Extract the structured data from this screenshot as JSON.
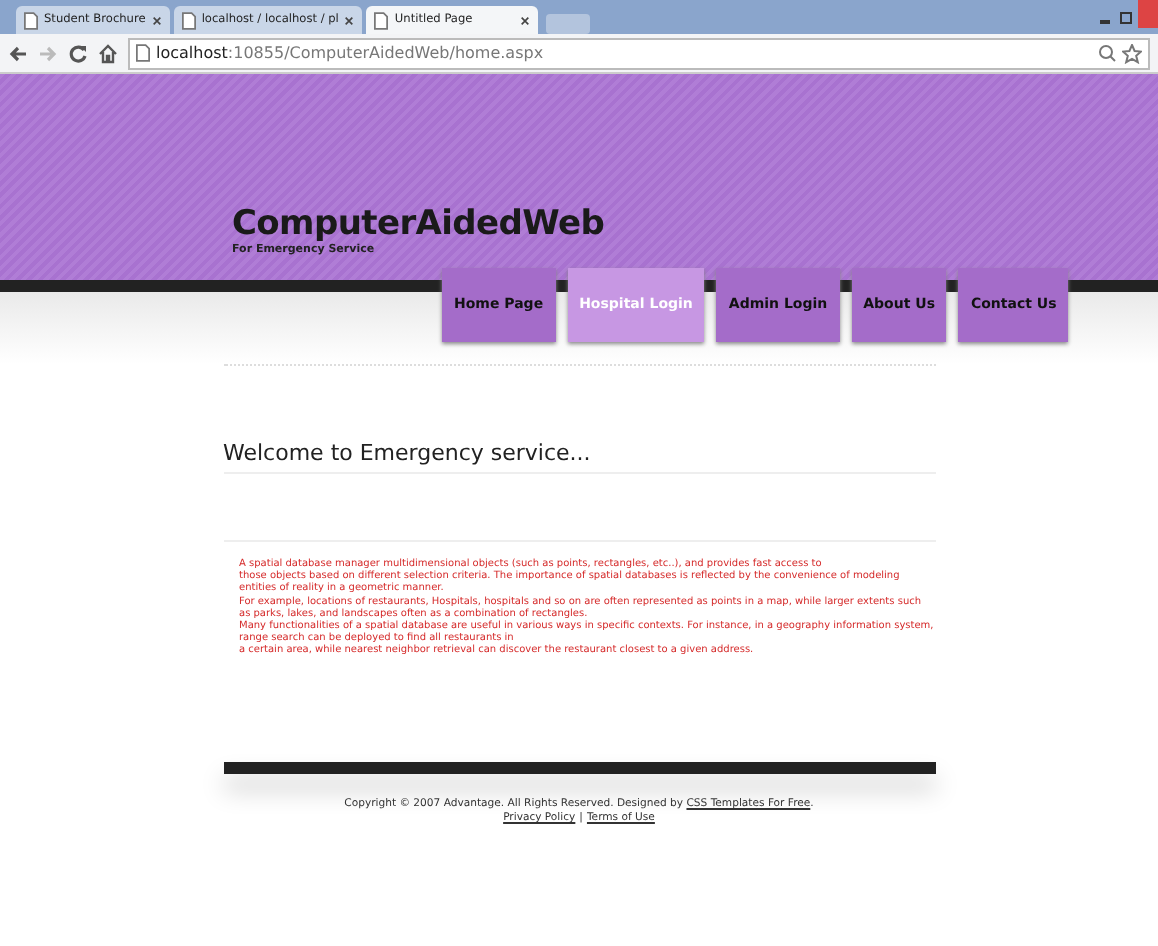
{
  "browser": {
    "tabs": [
      {
        "title": "Student Brochure",
        "selected": false
      },
      {
        "title": "localhost / localhost / pl",
        "selected": false
      },
      {
        "title": "Untitled Page",
        "selected": true
      }
    ],
    "address": {
      "host": "localhost",
      "rest": ":10855/ComputerAidedWeb/home.aspx"
    }
  },
  "site": {
    "title": "ComputerAidedWeb",
    "tagline": "For Emergency Service"
  },
  "nav": [
    {
      "label": "Home Page",
      "selected": false
    },
    {
      "label": "Hospital Login",
      "selected": true
    },
    {
      "label": "Admin Login",
      "selected": false
    },
    {
      "label": "About Us",
      "selected": false
    },
    {
      "label": "Contact Us",
      "selected": false
    }
  ],
  "heading": "Welcome to Emergency service...",
  "body_lines": [
    "A spatial database manager multidimensional objects (such as points, rectangles, etc..), and provides fast access to",
    "those objects based on different selection criteria. The importance of spatial databases is reflected by the convenience of modeling entities of reality in a geometric manner.",
    "For example, locations of restaurants, Hospitals, hospitals and so on are often represented as points in a map, while larger extents such as parks, lakes, and landscapes often as a combination of rectangles.",
    "Many functionalities of a spatial database are useful in various ways in specific contexts. For instance, in a geography information system, range search can be deployed to find all restaurants in",
    "a certain area, while nearest neighbor retrieval can discover the restaurant closest to a given address."
  ],
  "footer": {
    "copyright": "Copyright © 2007 Advantage. All Rights Reserved. Designed by",
    "designer_link": "CSS Templates For Free",
    "end": ".",
    "separator": "|",
    "links": [
      "Privacy Policy",
      "Terms of Use"
    ]
  }
}
